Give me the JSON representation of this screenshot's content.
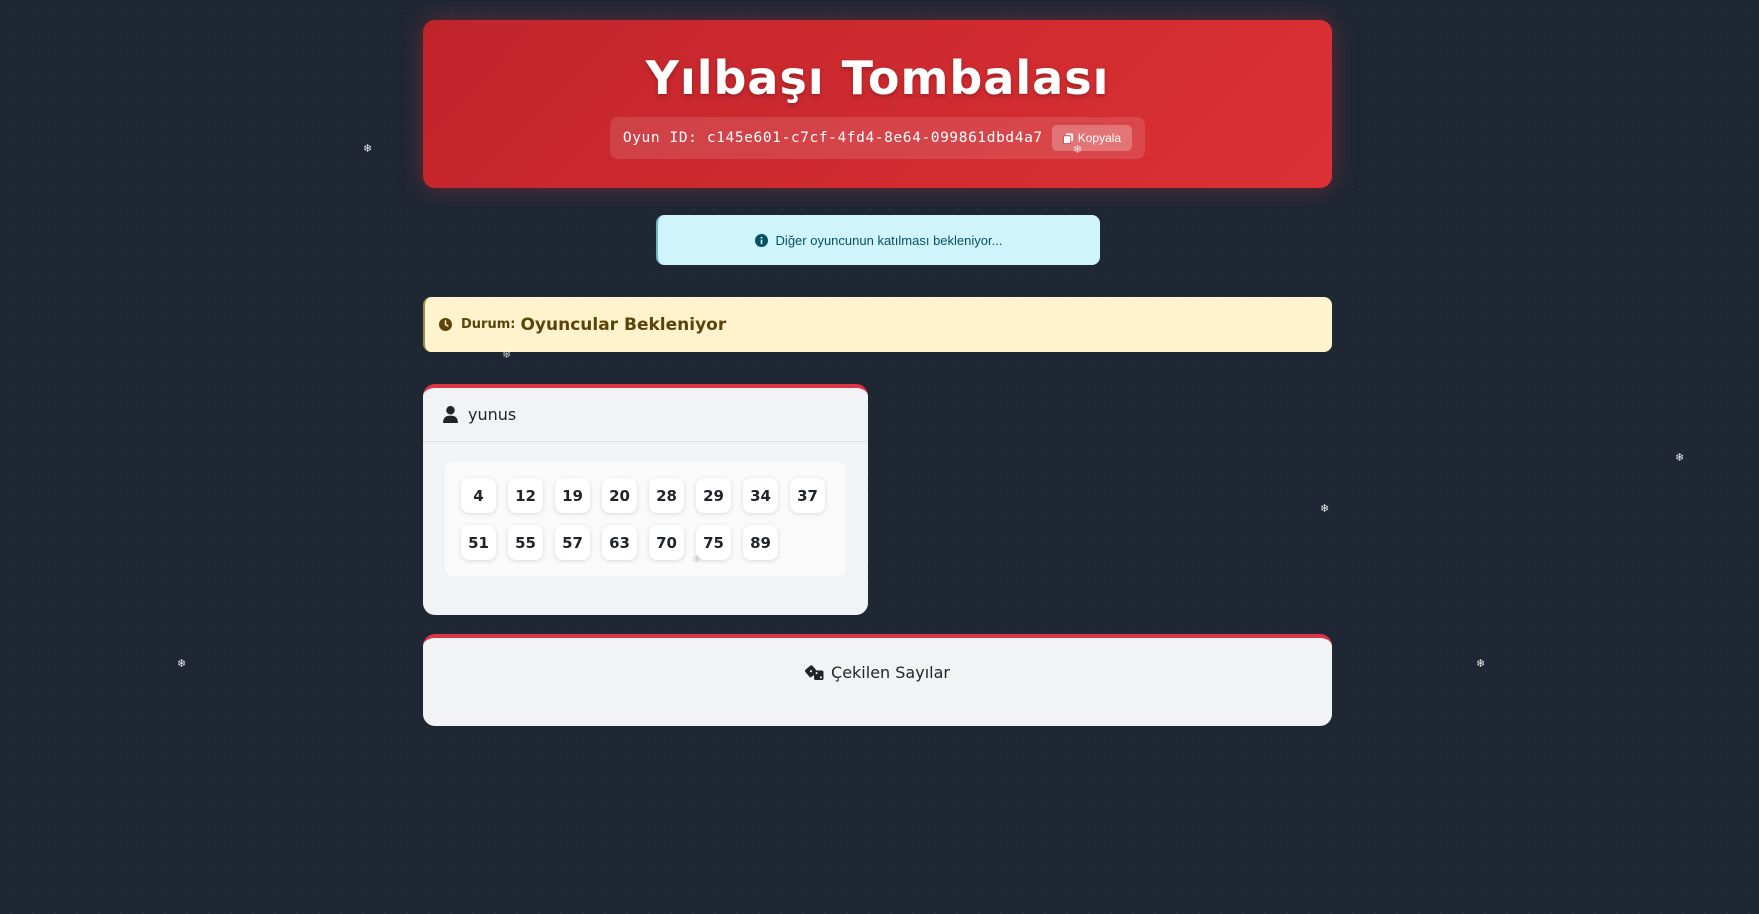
{
  "header": {
    "title": "Yılbaşı Tombalası",
    "game_id_label": "Oyun ID:",
    "game_id": "c145e601-c7cf-4fd4-8e64-099861dbd4a7",
    "copy_label": "Kopyala"
  },
  "info_alert": {
    "icon": "info-circle-icon",
    "text": "Diğer oyuncunun katılması bekleniyor..."
  },
  "status": {
    "icon": "clock-icon",
    "label": "Durum:",
    "value": "Oyuncular Bekleniyor"
  },
  "player": {
    "icon": "user-icon",
    "name": "yunus",
    "numbers": [
      4,
      12,
      19,
      20,
      28,
      29,
      34,
      37,
      51,
      55,
      57,
      63,
      70,
      75,
      89
    ]
  },
  "drawn": {
    "icon": "dice-icon",
    "title": "Çekilen Sayılar"
  },
  "decor": {
    "snowflake_glyph": "❄"
  },
  "colors": {
    "background": "#1f2735",
    "header_red": "#dc3134",
    "info_bg": "#cff4fc",
    "status_bg": "#fff3cd",
    "card_accent": "#dc3545"
  }
}
